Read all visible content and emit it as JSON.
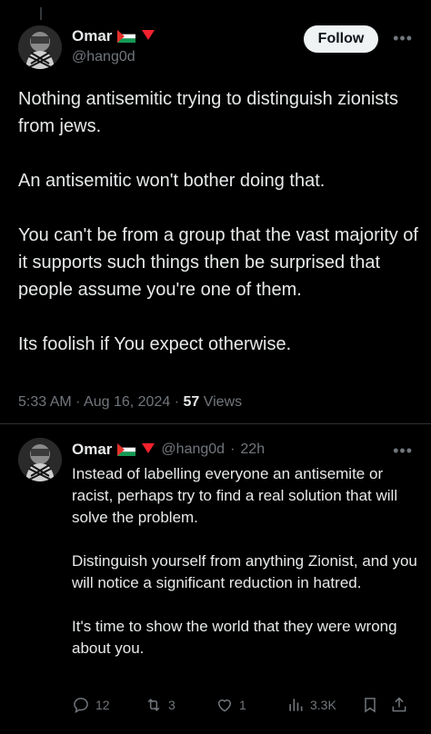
{
  "tweet": {
    "author_name": "Omar",
    "author_handle": "@hang0d",
    "follow_label": "Follow",
    "text": "Nothing antisemitic trying to distinguish zionists from jews.\n\nAn antisemitic won't bother doing that.\n\nYou can't be from a group that the vast majority of it supports such things then be surprised that people assume you're one of them.\n\nIts foolish if You expect otherwise.",
    "time": "5:33 AM",
    "date": "Aug 16, 2024",
    "views_count": "57",
    "views_label": "Views"
  },
  "reply": {
    "author_name": "Omar",
    "author_handle": "@hang0d",
    "age": "22h",
    "text": "Instead of labelling everyone an antisemite or racist, perhaps try to find a real solution that will solve the problem.\n\nDistinguish yourself from anything Zionist, and you will notice a significant reduction in hatred.\n\nIt's time to show the world that they were wrong about you.",
    "reply_count": "12",
    "retweet_count": "3",
    "like_count": "1",
    "view_count": "3.3K"
  },
  "icons": {
    "flag": "palestine-flag-icon",
    "badge": "red-triangle-icon",
    "more": "more-dots-icon"
  },
  "colors": {
    "background": "#000000",
    "text": "#e7e9ea",
    "muted": "#71767b",
    "divider": "#2f3336",
    "follow_bg": "#eff3f4"
  }
}
